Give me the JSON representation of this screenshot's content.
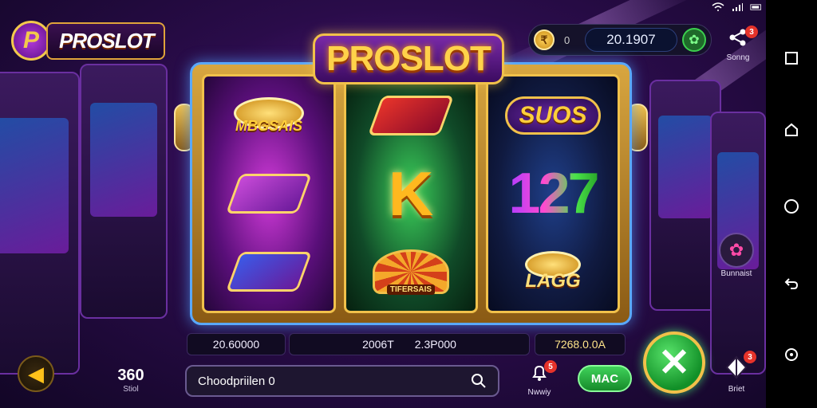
{
  "app": {
    "logo_text": "PROSLOT",
    "logo_badge": "P",
    "title": "PROSLOT"
  },
  "header": {
    "balance_coin": "₹",
    "balance_zero": "0",
    "balance_value": "20.1907",
    "share_label": "Sonng",
    "share_badge": "3"
  },
  "reels": [
    {
      "symbols": [
        {
          "name": "coin-pile-symbol",
          "text": "MBGSAIS"
        },
        {
          "name": "boomerang-symbol",
          "text": ""
        },
        {
          "name": "boomerang-symbol",
          "text": ""
        }
      ]
    },
    {
      "symbols": [
        {
          "name": "boomerang-symbol",
          "text": ""
        },
        {
          "name": "letter-symbol",
          "text": "K"
        },
        {
          "name": "wheel-symbol",
          "text": "TIFERSAIS"
        }
      ]
    },
    {
      "symbols": [
        {
          "name": "character-symbol",
          "text": "SUOS"
        },
        {
          "name": "number-symbol",
          "text": "127"
        },
        {
          "name": "coin-pile-symbol",
          "text": "LAGG"
        }
      ]
    }
  ],
  "stats": {
    "left_value": "20.60000",
    "middle_value_a": "2006T",
    "middle_value_b": "2.3P000",
    "right_value": "7268.0.0A"
  },
  "controls": {
    "bet_value": "360",
    "bet_label": "Stiol",
    "search_placeholder": "Choodpriilen 0",
    "notif_label": "Nwwiy",
    "notif_badge": "5",
    "mac_label": "MAC",
    "spin_symbol": "✕",
    "settings_label": "Bunnaist",
    "bet_side_label": "Briet",
    "bet_side_badge": "3"
  },
  "colors": {
    "accent_gold": "#f1c14a",
    "spin_green": "#129028",
    "frame_blue": "#5aa8ff"
  },
  "icons": {
    "back": "arrow-left-icon",
    "search": "magnifier-icon",
    "share": "share-icon",
    "settings": "gear-icon",
    "bet": "diamond-icon",
    "notify": "bell-icon"
  }
}
